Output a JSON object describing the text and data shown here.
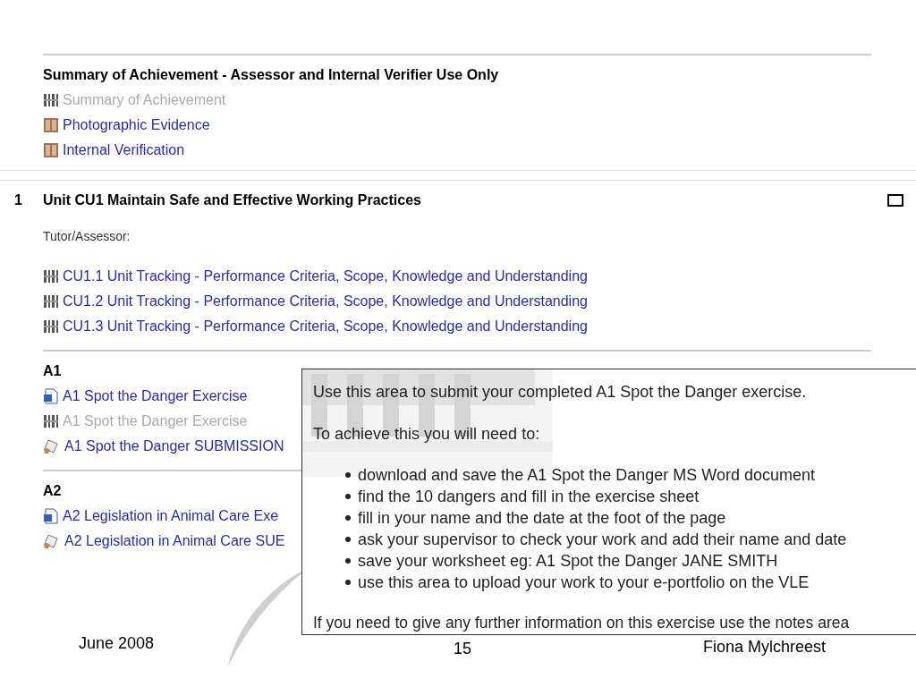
{
  "summary_section": {
    "heading": "Summary of Achievement - Assessor and Internal Verifier Use Only",
    "items": [
      {
        "kind": "tracker",
        "label": "Summary of Achievement",
        "disabled": true
      },
      {
        "kind": "folder",
        "label": "Photographic Evidence",
        "disabled": false
      },
      {
        "kind": "folder",
        "label": "Internal Verification",
        "disabled": false
      }
    ]
  },
  "unit_section": {
    "number": "1",
    "heading": "Unit CU1 Maintain Safe and Effective Working Practices",
    "tutor_label": "Tutor/Assessor:",
    "checked": false,
    "items": [
      {
        "kind": "tracker",
        "label": "CU1.1 Unit Tracking - Performance Criteria, Scope, Knowledge and Understanding",
        "disabled": false
      },
      {
        "kind": "tracker",
        "label": "CU1.2 Unit Tracking - Performance Criteria, Scope, Knowledge and Understanding",
        "disabled": false
      },
      {
        "kind": "tracker",
        "label": "CU1.3 Unit Tracking - Performance Criteria, Scope, Knowledge and Understanding",
        "disabled": false
      }
    ],
    "groups": [
      {
        "heading": "A1",
        "items": [
          {
            "kind": "word",
            "label": "A1 Spot the Danger Exercise",
            "disabled": false
          },
          {
            "kind": "tracker",
            "label": "A1 Spot the Danger Exercise",
            "disabled": true
          },
          {
            "kind": "assignment",
            "label": "A1 Spot the Danger SUBMISSION",
            "disabled": false
          }
        ]
      },
      {
        "heading": "A2",
        "items": [
          {
            "kind": "word",
            "label": "A2 Legislation in Animal Care Exe",
            "disabled": false
          },
          {
            "kind": "assignment",
            "label": "A2 Legislation in Animal Care SUE",
            "disabled": false
          }
        ]
      }
    ]
  },
  "popup": {
    "intro": "Use this area to submit your completed A1 Spot the Danger exercise.",
    "lead": "To achieve this you will need to:",
    "steps": [
      "download and save the A1 Spot the Danger MS Word document",
      "find the 10 dangers and fill in the exercise sheet",
      "fill in your name and the date at the foot of the page",
      "ask your supervisor to check your work and add their name and date",
      "save your worksheet eg: A1 Spot the Danger JANE SMITH",
      "use this area to upload your work to your e-portfolio on the VLE"
    ],
    "outro": "If you need to give any further information on this exercise use the notes area"
  },
  "footer": {
    "date": "June 2008",
    "page": "15",
    "author": "Fiona Mylchreest"
  }
}
